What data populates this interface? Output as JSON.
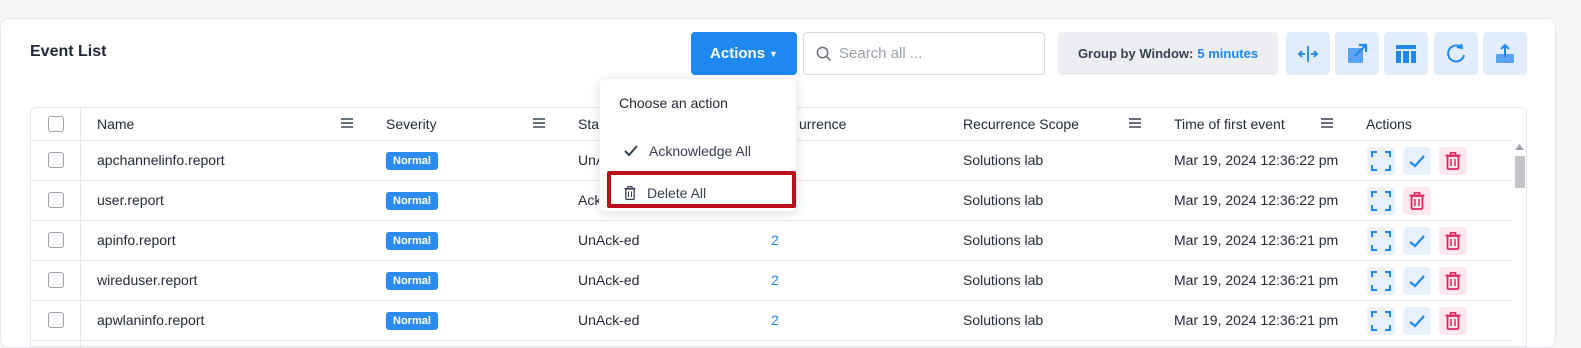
{
  "page": {
    "title": "Event List"
  },
  "toolbar": {
    "actions_label": "Actions",
    "search_placeholder": "Search all ...",
    "group_label": "Group by Window:",
    "group_value": "5 minutes"
  },
  "dropdown": {
    "header": "Choose an action",
    "items": [
      {
        "label": "Acknowledge All",
        "icon": "check-icon"
      },
      {
        "label": "Delete All",
        "icon": "trash-icon"
      }
    ]
  },
  "table": {
    "columns": [
      "Name",
      "Severity",
      "Status",
      "Recurrence",
      "Recurrence Scope",
      "Time of first event",
      "Actions"
    ],
    "visible_headers": {
      "name": "Name",
      "severity": "Severity",
      "status": "Stat",
      "recurrence": "urrence",
      "scope": "Recurrence Scope",
      "time": "Time of first event",
      "actions": "Actions"
    },
    "rows": [
      {
        "name": "apchannelinfo.report",
        "severity": "Normal",
        "status": "UnA",
        "recurrence": "",
        "scope": "Solutions lab",
        "time": "Mar 19, 2024 12:36:22 pm",
        "acknowledged": false
      },
      {
        "name": "user.report",
        "severity": "Normal",
        "status": "Ack",
        "recurrence": "",
        "scope": "Solutions lab",
        "time": "Mar 19, 2024 12:36:22 pm",
        "acknowledged": true
      },
      {
        "name": "apinfo.report",
        "severity": "Normal",
        "status": "UnAck-ed",
        "recurrence": "2",
        "scope": "Solutions lab",
        "time": "Mar 19, 2024 12:36:21 pm",
        "acknowledged": false
      },
      {
        "name": "wireduser.report",
        "severity": "Normal",
        "status": "UnAck-ed",
        "recurrence": "2",
        "scope": "Solutions lab",
        "time": "Mar 19, 2024 12:36:21 pm",
        "acknowledged": false
      },
      {
        "name": "apwlaninfo.report",
        "severity": "Normal",
        "status": "UnAck-ed",
        "recurrence": "2",
        "scope": "Solutions lab",
        "time": "Mar 19, 2024 12:36:21 pm",
        "acknowledged": false
      }
    ]
  },
  "colors": {
    "accent": "#1e88f0",
    "badge": "#2d8cf0",
    "delete": "#e0245e",
    "highlight": "#b8101a"
  }
}
